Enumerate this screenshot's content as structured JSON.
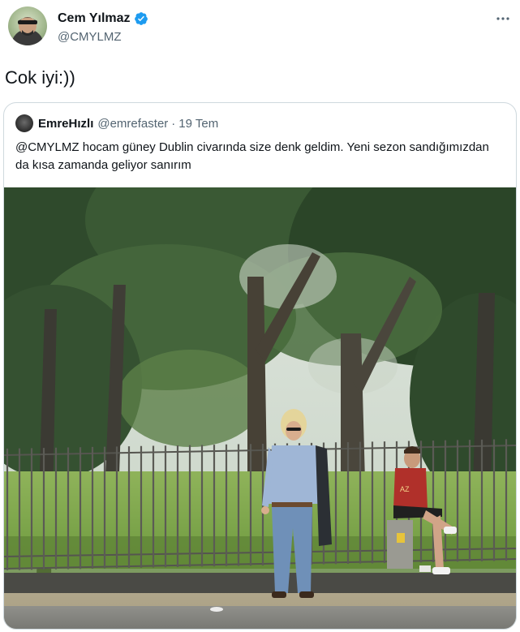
{
  "tweet": {
    "author_name": "Cem Yılmaz",
    "author_handle": "@CMYLMZ",
    "text": "Cok iyi:))",
    "more_label": "···"
  },
  "quoted": {
    "author_name": "EmreHızlı",
    "author_handle": "@emrefaster",
    "separator": "·",
    "date": "19 Tem",
    "text": "@CMYLMZ hocam güney Dublin civarında size denk geldim. Yeni sezon sandığımızdan da kısa zamanda geliyor sanırım"
  },
  "icons": {
    "verified": "verified-badge-icon",
    "more": "more-options-icon"
  },
  "colors": {
    "verified": "#1d9bf0",
    "secondary_text": "#536471",
    "border": "#cfd9de"
  }
}
